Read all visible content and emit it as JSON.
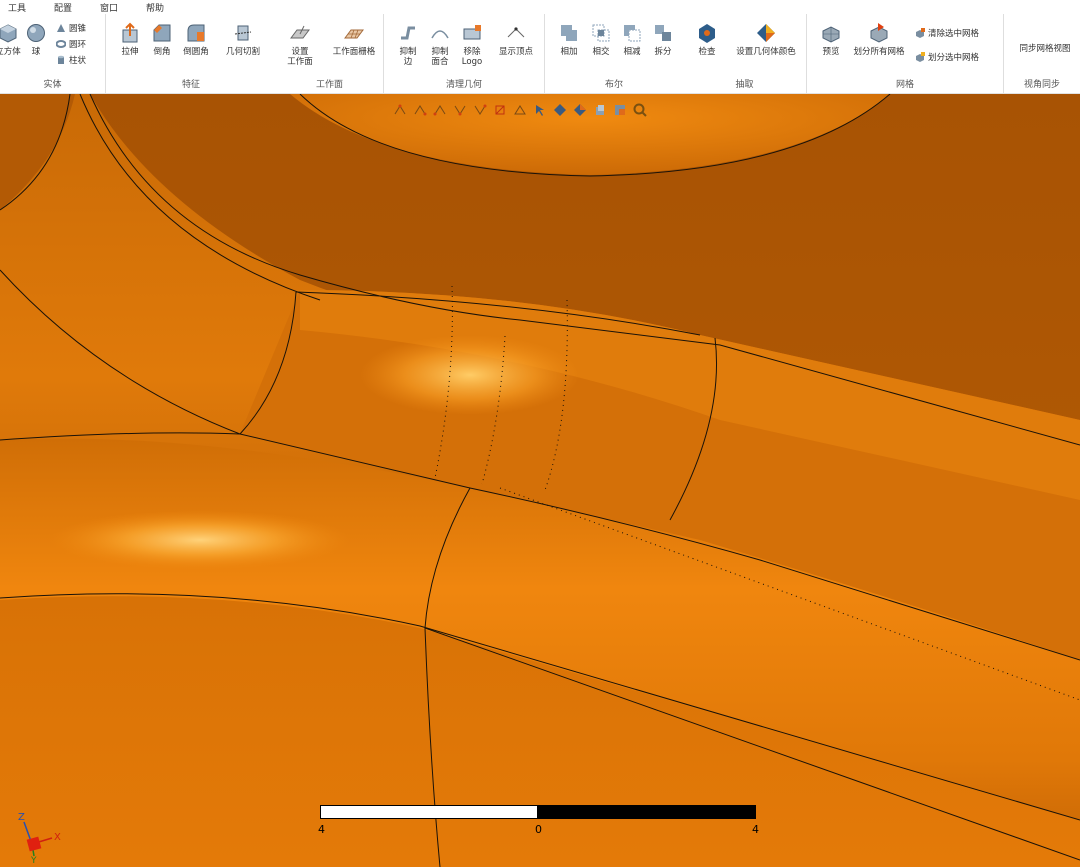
{
  "menu": [
    "工具",
    "配置",
    "窗口",
    "帮助"
  ],
  "ribbon": {
    "groups": {
      "solid": {
        "label": "实体",
        "buttons": {
          "cube": "立方体",
          "sphere": "球"
        },
        "small": {
          "cone": "圆锥",
          "torus": "圆环",
          "cylinder": "柱状"
        }
      },
      "feature": {
        "label": "特征",
        "buttons": {
          "extrude": "拉伸",
          "chamfer": "倒角",
          "fillet": "倒圆角",
          "cut": "几何切割"
        }
      },
      "workplane": {
        "label": "工作面",
        "buttons": {
          "set_workplane": "设置\n工作面",
          "workplane_grid": "工作面栅格"
        }
      },
      "clean": {
        "label": "清理几何",
        "buttons": {
          "suppress_edge": "抑制\n边",
          "suppress_face": "抑制\n面合",
          "remove_logo": "移除\nLogo",
          "show_vertex": "显示顶点"
        }
      },
      "boolean": {
        "label": "布尔",
        "buttons": {
          "union": "相加",
          "intersect": "相交",
          "subtract": "相减",
          "split": "拆分"
        }
      },
      "extract": {
        "label": "抽取",
        "buttons": {
          "check": "检查",
          "set_color": "设置几何体颜色"
        }
      },
      "mesh": {
        "label": "网格",
        "buttons": {
          "preview": "预览",
          "mesh_all": "划分所有网格"
        },
        "small": {
          "clear_selected": "清除选中网格",
          "mesh_selected": "划分选中网格"
        }
      },
      "view": {
        "label": "视角同步",
        "buttons": {
          "sync_view": "同步网格视图"
        }
      }
    }
  },
  "viewport": {
    "model_color": "#e07808",
    "edge_color": "#1a1208"
  },
  "scale_bar": {
    "left": "4",
    "center": "0",
    "right": "4"
  },
  "axis_triad": {
    "z": "Z",
    "x": "X",
    "y": "Y"
  }
}
